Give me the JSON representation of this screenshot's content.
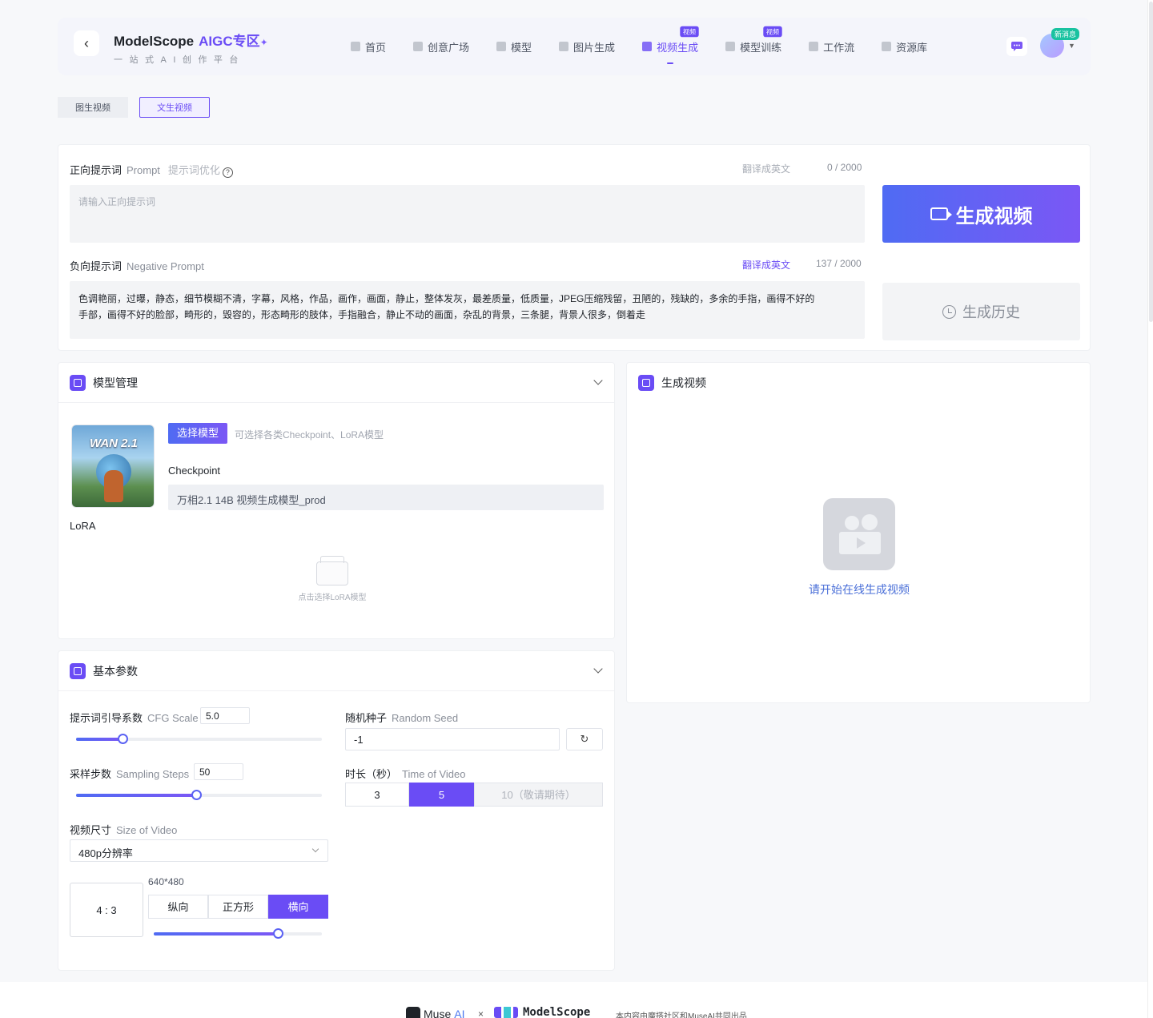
{
  "header": {
    "brand": "ModelScope",
    "aigc": "AIGC专区",
    "tagline": "一站式AI创作平台",
    "nav": [
      {
        "label": "首页",
        "icon": "home-icon",
        "active": false,
        "badge": ""
      },
      {
        "label": "创意广场",
        "icon": "flask-icon",
        "active": false,
        "badge": ""
      },
      {
        "label": "模型",
        "icon": "cube-icon",
        "active": false,
        "badge": ""
      },
      {
        "label": "图片生成",
        "icon": "image-icon",
        "active": false,
        "badge": ""
      },
      {
        "label": "视频生成",
        "icon": "video-icon",
        "active": true,
        "badge": "视频"
      },
      {
        "label": "模型训练",
        "icon": "train-icon",
        "active": false,
        "badge": "视频"
      },
      {
        "label": "工作流",
        "icon": "workflow-icon",
        "active": false,
        "badge": ""
      },
      {
        "label": "资源库",
        "icon": "library-icon",
        "active": false,
        "badge": ""
      }
    ],
    "new_badge": "新消息"
  },
  "mode_tabs": [
    {
      "label": "图生视频",
      "active": false
    },
    {
      "label": "文生视频",
      "active": true
    }
  ],
  "prompt": {
    "label": "正向提示词",
    "label_en": "Prompt",
    "optimize": "提示词优化",
    "translate": "翻译成英文",
    "counter": "0 / 2000",
    "placeholder": "请输入正向提示词"
  },
  "negative": {
    "label": "负向提示词",
    "label_en": "Negative Prompt",
    "translate": "翻译成英文",
    "counter": "137 / 2000",
    "line1": "色调艳丽，过曝，静态，细节模糊不清，字幕，风格，作品，画作，画面，静止，整体发灰，最差质量，低质量，JPEG压缩残留，丑陋的，残缺的，多余的手指，画得不好的",
    "line2": "手部，画得不好的脸部，畸形的，毁容的，形态畸形的肢体，手指融合，静止不动的画面，杂乱的背景，三条腿，背景人很多，倒着走"
  },
  "actions": {
    "generate": "生成视频",
    "history": "生成历史"
  },
  "model": {
    "title": "模型管理",
    "thumb_text": "WAN 2.1",
    "select_btn": "选择模型",
    "select_hint": "可选择各类Checkpoint、LoRA模型",
    "checkpoint_label": "Checkpoint",
    "checkpoint_value": "万相2.1 14B 视频生成模型_prod",
    "lora_label": "LoRA",
    "lora_empty": "点击选择LoRA模型"
  },
  "params": {
    "title": "基本参数",
    "cfg_label": "提示词引导系数",
    "cfg_en": "CFG Scale",
    "cfg_value": "5.0",
    "cfg_fraction": 0.19,
    "steps_label": "采样步数",
    "steps_en": "Sampling Steps",
    "steps_value": "50",
    "steps_fraction": 0.49,
    "size_label": "视频尺寸",
    "size_en": "Size of Video",
    "size_value": "480p分辨率",
    "ratio": "4 : 3",
    "dims": "640*480",
    "orientations": [
      {
        "label": "纵向",
        "active": false
      },
      {
        "label": "正方形",
        "active": false
      },
      {
        "label": "横向",
        "active": true
      }
    ],
    "orientation_fraction": 0.74,
    "seed_label": "随机种子",
    "seed_en": "Random Seed",
    "seed_value": "-1",
    "duration_label": "时长（秒）",
    "duration_en": "Time of Video",
    "durations": [
      {
        "label": "3",
        "state": "normal"
      },
      {
        "label": "5",
        "state": "on"
      },
      {
        "label": "10（敬请期待）",
        "state": "off"
      }
    ]
  },
  "video": {
    "title": "生成视频",
    "empty": "请开始在线生成视频"
  },
  "footer": {
    "muse": "Muse",
    "ai": "AI",
    "x": "×",
    "modelscope": "ModelScope",
    "note": "本内容由魔搭社区和MuseAI共同出品"
  },
  "colors": {
    "accent": "#6a4cf5",
    "gradient_start": "#4f6bf3",
    "gradient_end": "#7b57f5"
  }
}
